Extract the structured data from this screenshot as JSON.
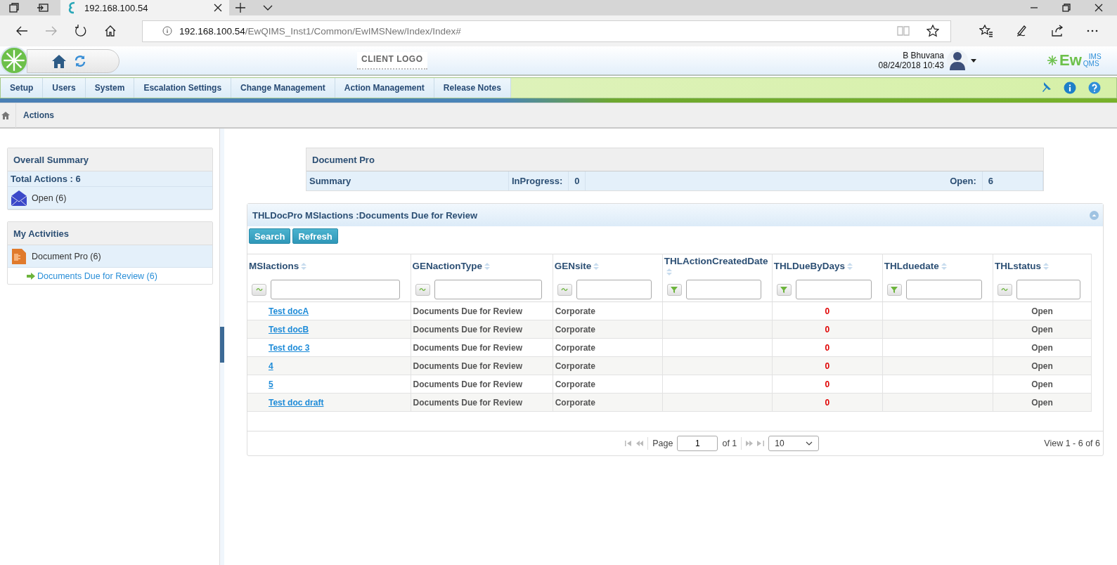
{
  "browser": {
    "tab_title": "192.168.100.54",
    "url_host": "192.168.100.54",
    "url_path": "/EwQIMS_Inst1/Common/EwIMSNew/Index/Index#"
  },
  "header": {
    "client_logo": "CLIENT LOGO",
    "user_name": "B Bhuvana",
    "datetime": "08/24/2018 10:43",
    "brand": {
      "main": "Ew",
      "top": "IMS",
      "bottom": "QMS"
    }
  },
  "nav": {
    "items": [
      {
        "label": "Setup"
      },
      {
        "label": "Users"
      },
      {
        "label": "System"
      },
      {
        "label": "Escalation Settings"
      },
      {
        "label": "Change Management"
      },
      {
        "label": "Action Management"
      },
      {
        "label": "Release Notes"
      }
    ]
  },
  "breadcrumb": {
    "current": "Actions"
  },
  "sidebar": {
    "overall_summary": {
      "title": "Overall Summary",
      "total": "Total Actions : 6",
      "items": [
        {
          "label": "Open (6)"
        }
      ]
    },
    "my_activities": {
      "title": "My Activities",
      "items": [
        {
          "label": "Document Pro (6)",
          "children": [
            {
              "label": "Documents Due for Review (6)"
            }
          ]
        }
      ]
    }
  },
  "summary_panel": {
    "title": "Document Pro",
    "row_label": "Summary",
    "fields": [
      {
        "label": "InProgress:",
        "value": "0"
      },
      {
        "label": "Open:",
        "value": "6"
      }
    ]
  },
  "grid": {
    "title": "THLDocPro MSIactions :Documents Due for Review",
    "buttons": [
      "Search",
      "Refresh"
    ],
    "columns": [
      {
        "label": "MSIactions",
        "kind": "contains"
      },
      {
        "label": "GENactionType",
        "kind": "contains"
      },
      {
        "label": "GENsite",
        "kind": "contains"
      },
      {
        "label": "THLActionCreatedDate",
        "kind": "funnel"
      },
      {
        "label": "THLDueByDays",
        "kind": "funnel"
      },
      {
        "label": "THLduedate",
        "kind": "funnel"
      },
      {
        "label": "THLstatus",
        "kind": "contains"
      }
    ],
    "rows": [
      {
        "msi_action": "Test docA",
        "action_type": "Documents Due for Review",
        "site": "Corporate",
        "due_by_days": "0",
        "status": "Open"
      },
      {
        "msi_action": "Test docB",
        "action_type": "Documents Due for Review",
        "site": "Corporate",
        "due_by_days": "0",
        "status": "Open"
      },
      {
        "msi_action": "Test doc 3",
        "action_type": "Documents Due for Review",
        "site": "Corporate",
        "due_by_days": "0",
        "status": "Open"
      },
      {
        "msi_action": "4",
        "action_type": "Documents Due for Review",
        "site": "Corporate",
        "due_by_days": "0",
        "status": "Open"
      },
      {
        "msi_action": "5",
        "action_type": "Documents Due for Review",
        "site": "Corporate",
        "due_by_days": "0",
        "status": "Open"
      },
      {
        "msi_action": "Test doc draft",
        "action_type": "Documents Due for Review",
        "site": "Corporate",
        "due_by_days": "0",
        "status": "Open"
      }
    ],
    "pager": {
      "page_label": "Page",
      "page": "1",
      "of": "of 1",
      "page_size": "10",
      "view": "View 1 - 6 of 6"
    }
  }
}
